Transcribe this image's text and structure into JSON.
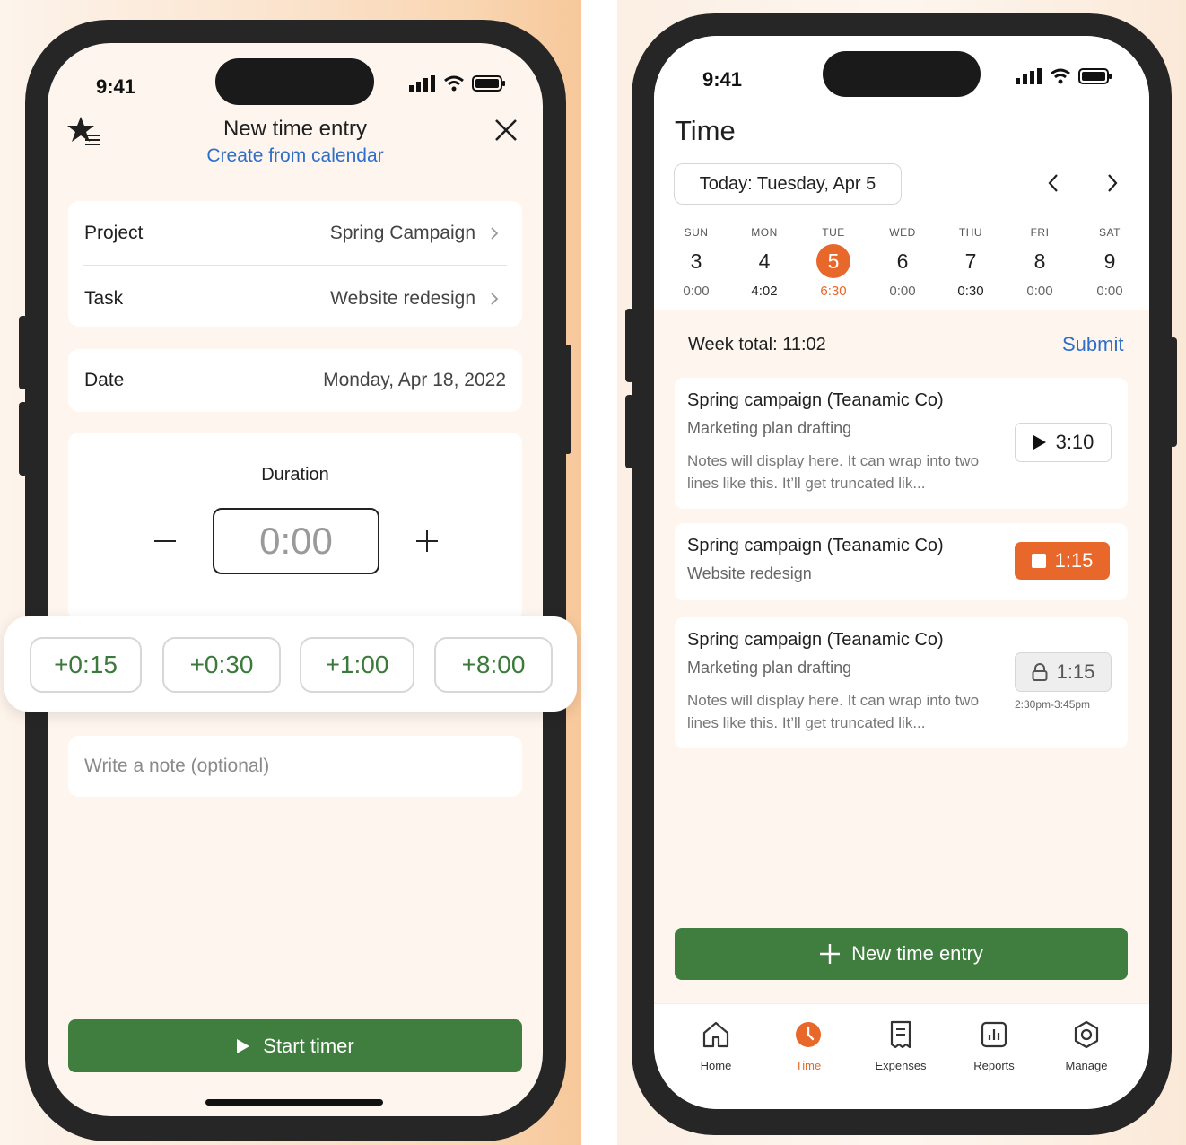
{
  "left": {
    "status_time": "9:41",
    "title": "New time entry",
    "subtitle_link": "Create from calendar",
    "project": {
      "label": "Project",
      "value": "Spring Campaign"
    },
    "task": {
      "label": "Task",
      "value": "Website redesign"
    },
    "date": {
      "label": "Date",
      "value": "Monday, Apr 18, 2022"
    },
    "duration": {
      "label": "Duration",
      "value": "0:00"
    },
    "quick_add": [
      "+0:15",
      "+0:30",
      "+1:00",
      "+8:00"
    ],
    "note_placeholder": "Write a note (optional)",
    "start_button": "Start timer"
  },
  "right": {
    "status_time": "9:41",
    "title": "Time",
    "date_pill": "Today: Tuesday, Apr 5",
    "days": [
      {
        "name": "SUN",
        "num": "3",
        "hours": "0:00"
      },
      {
        "name": "MON",
        "num": "4",
        "hours": "4:02"
      },
      {
        "name": "TUE",
        "num": "5",
        "hours": "6:30"
      },
      {
        "name": "WED",
        "num": "6",
        "hours": "0:00"
      },
      {
        "name": "THU",
        "num": "7",
        "hours": "0:30"
      },
      {
        "name": "FRI",
        "num": "8",
        "hours": "0:00"
      },
      {
        "name": "SAT",
        "num": "9",
        "hours": "0:00"
      }
    ],
    "week_total": "Week total: 11:02",
    "submit": "Submit",
    "entries": [
      {
        "title": "Spring campaign (Teanamic Co)",
        "task": "Marketing plan drafting",
        "notes": "Notes will display here. It can wrap into two lines like this. It’ll get truncated lik...",
        "time": "3:10"
      },
      {
        "title": "Spring campaign (Teanamic Co)",
        "task": "Website redesign",
        "time": "1:15"
      },
      {
        "title": "Spring campaign (Teanamic Co)",
        "task": "Marketing plan drafting",
        "notes": "Notes will display here. It can wrap into two lines like this. It’ll get truncated lik...",
        "time": "1:15",
        "range": "2:30pm-3:45pm"
      }
    ],
    "new_entry_button": "New time entry",
    "tabs": [
      {
        "label": "Home",
        "icon": "home-icon"
      },
      {
        "label": "Time",
        "icon": "clock-icon"
      },
      {
        "label": "Expenses",
        "icon": "receipt-icon"
      },
      {
        "label": "Reports",
        "icon": "chart-icon"
      },
      {
        "label": "Manage",
        "icon": "settings-icon"
      }
    ]
  },
  "colors": {
    "accent_green": "#3f7e3e",
    "accent_orange": "#e8672a",
    "link_blue": "#2f6ec8"
  }
}
